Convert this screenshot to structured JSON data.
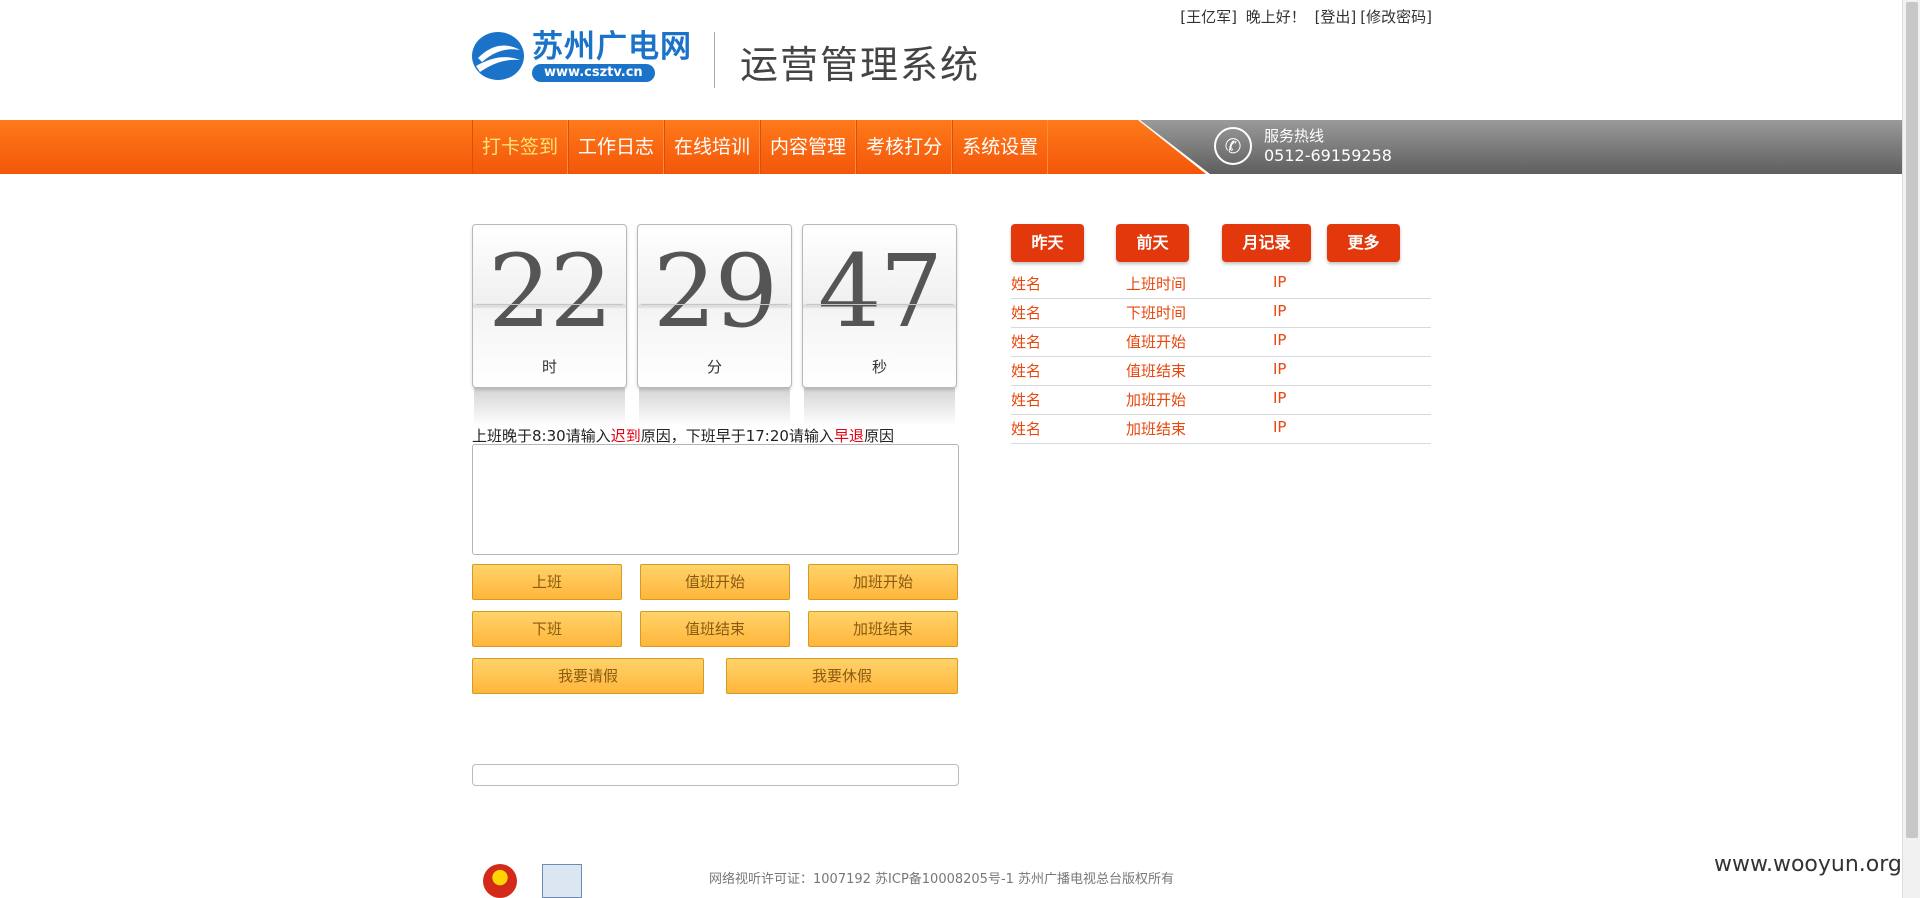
{
  "header": {
    "user_name": "[王亿军]",
    "greeting": "晚上好！",
    "logout": "[登出]",
    "change_password": "[修改密码]",
    "logo_cn": "苏州广电网",
    "logo_url": "www.csztv.cn",
    "system_title": "运营管理系统"
  },
  "nav": {
    "items": [
      "打卡签到",
      "工作日志",
      "在线培训",
      "内容管理",
      "考核打分",
      "系统设置"
    ],
    "active_index": 0
  },
  "hotline": {
    "label": "服务热线",
    "number": "0512-69159258"
  },
  "clock": {
    "hours": "22",
    "minutes": "29",
    "seconds": "47",
    "hours_label": "时",
    "minutes_label": "分",
    "seconds_label": "秒"
  },
  "notice": {
    "part1": "上班晚于8:30请输入",
    "late": "迟到",
    "part2": "原因，下班早于17:20请输入",
    "early": "早退",
    "part3": "原因"
  },
  "reason_input": {
    "value": ""
  },
  "buttons": {
    "checkin": "上班",
    "duty_start": "值班开始",
    "overtime_start": "加班开始",
    "checkout": "下班",
    "duty_end": "值班结束",
    "overtime_end": "加班结束",
    "leave": "我要请假",
    "rest": "我要休假"
  },
  "tabs": {
    "yesterday": "昨天",
    "day_before": "前天",
    "monthly": "月记录",
    "more": "更多"
  },
  "records": [
    {
      "name": "姓名",
      "type": "上班时间",
      "ip": "IP"
    },
    {
      "name": "姓名",
      "type": "下班时间",
      "ip": "IP"
    },
    {
      "name": "姓名",
      "type": "值班开始",
      "ip": "IP"
    },
    {
      "name": "姓名",
      "type": "值班结束",
      "ip": "IP"
    },
    {
      "name": "姓名",
      "type": "加班开始",
      "ip": "IP"
    },
    {
      "name": "姓名",
      "type": "加班结束",
      "ip": "IP"
    }
  ],
  "footer": {
    "license": "网络视听许可证：1007192 苏ICP备10008205号-1 苏州广播电视总台版权所有"
  },
  "watermark": "www.wooyun.org",
  "colors": {
    "nav_orange": "#f3560a",
    "tab_red": "#e2380c",
    "record_text": "#e8470e",
    "button_yellow": "#ffb63b",
    "brand_blue": "#1a73c8"
  }
}
